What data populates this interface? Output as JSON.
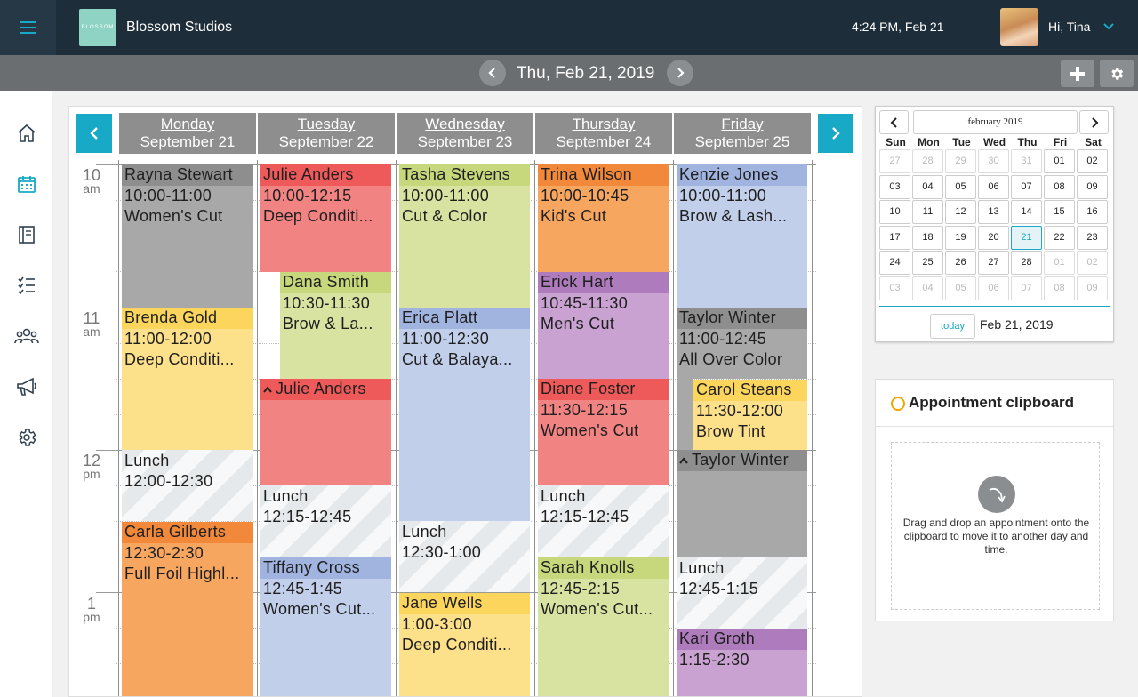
{
  "header": {
    "brand": "Blossom Studios",
    "logo_text": "BLOSSOM",
    "time": "4:24 PM, Feb 21",
    "greeting": "Hi, Tina"
  },
  "datebar": {
    "title": "Thu, Feb 21, 2019"
  },
  "sidebar": {
    "items": [
      "home-icon",
      "calendar-icon",
      "book-icon",
      "checklist-icon",
      "people-icon",
      "megaphone-icon",
      "gear-icon"
    ]
  },
  "calendar": {
    "days": [
      {
        "name": "Monday",
        "date": "September 21"
      },
      {
        "name": "Tuesday",
        "date": "September 22"
      },
      {
        "name": "Wednesday",
        "date": "September 23"
      },
      {
        "name": "Thursday",
        "date": "September 24"
      },
      {
        "name": "Friday",
        "date": "September 25"
      }
    ],
    "hours": [
      {
        "h": "10",
        "ap": "am"
      },
      {
        "h": "11",
        "ap": "am"
      },
      {
        "h": "12",
        "ap": "pm"
      },
      {
        "h": "1",
        "ap": "pm"
      }
    ],
    "appointments": {
      "mon": [
        {
          "name": "Rayna Stewart",
          "time": "10:00-11:00",
          "service": "Women's Cut"
        },
        {
          "name": "Brenda Gold",
          "time": "11:00-12:00",
          "service": "Deep Conditi..."
        },
        {
          "name": "Lunch",
          "time": "12:00-12:30"
        },
        {
          "name": "Carla Gilberts",
          "time": "12:30-2:30",
          "service": "Full Foil Highl..."
        }
      ],
      "tue": [
        {
          "name": "Julie Anders",
          "time": "10:00-12:15",
          "service": "Deep Conditi..."
        },
        {
          "name": "Dana Smith",
          "time": "10:30-11:30",
          "service": "Brow & La..."
        },
        {
          "name": "Julie Anders"
        },
        {
          "name": "Lunch",
          "time": "12:15-12:45"
        },
        {
          "name": "Tiffany Cross",
          "time": "12:45-1:45",
          "service": "Women's Cut..."
        }
      ],
      "wed": [
        {
          "name": "Tasha Stevens",
          "time": "10:00-11:00",
          "service": "Cut & Color"
        },
        {
          "name": "Erica Platt",
          "time": "11:00-12:30",
          "service": "Cut & Balaya..."
        },
        {
          "name": "Lunch",
          "time": "12:30-1:00"
        },
        {
          "name": "Jane Wells",
          "time": "1:00-3:00",
          "service": "Deep Conditi..."
        }
      ],
      "thu": [
        {
          "name": "Trina Wilson",
          "time": "10:00-10:45",
          "service": "Kid's Cut"
        },
        {
          "name": "Erick Hart",
          "time": "10:45-11:30",
          "service": "Men's Cut"
        },
        {
          "name": "Diane Foster",
          "time": "11:30-12:15",
          "service": "Women's Cut"
        },
        {
          "name": "Lunch",
          "time": "12:15-12:45"
        },
        {
          "name": "Sarah Knolls",
          "time": "12:45-2:15",
          "service": "Women's Cut..."
        }
      ],
      "fri": [
        {
          "name": "Kenzie Jones",
          "time": "10:00-11:00",
          "service": "Brow & Lash..."
        },
        {
          "name": "Taylor Winter",
          "time": "11:00-12:45",
          "service": "All Over Color"
        },
        {
          "name": "Carol Steans",
          "time": "11:30-12:00",
          "service": "Brow Tint"
        },
        {
          "name": "Taylor Winter"
        },
        {
          "name": "Lunch",
          "time": "12:45-1:15"
        },
        {
          "name": "Kari Groth",
          "time": "1:15-2:30"
        }
      ]
    }
  },
  "minical": {
    "month": "february 2019",
    "dow": [
      "Sun",
      "Mon",
      "Tue",
      "Wed",
      "Thu",
      "Fri",
      "Sat"
    ],
    "weeks": [
      [
        "27",
        "28",
        "29",
        "30",
        "31",
        "01",
        "02"
      ],
      [
        "03",
        "04",
        "05",
        "06",
        "07",
        "08",
        "09"
      ],
      [
        "10",
        "11",
        "12",
        "13",
        "14",
        "15",
        "16"
      ],
      [
        "17",
        "18",
        "19",
        "20",
        "21",
        "22",
        "23"
      ],
      [
        "24",
        "25",
        "26",
        "27",
        "28",
        "01",
        "02"
      ],
      [
        "03",
        "04",
        "05",
        "06",
        "07",
        "08",
        "09"
      ]
    ],
    "selected": "21",
    "today_label": "today",
    "current_date": "Feb 21, 2019"
  },
  "clipboard": {
    "title": "Appointment clipboard",
    "hint": "Drag and drop an appointment onto the clipboard to move it to another day and time."
  },
  "colors": {
    "accent": "#17a9c6",
    "gray": "#a8a8a8",
    "gray_dark": "#8e8e8e",
    "red": "#f28383",
    "red_dark": "#ee5959",
    "green": "#d9e3a1",
    "green_dark": "#c7d77b",
    "orange": "#f7a660",
    "orange_dark": "#f2883a",
    "purple": "#c9a2d2",
    "purple_dark": "#ae7cbd",
    "blue": "#c2cfea",
    "blue_dark": "#a1b4df",
    "yellow": "#fde08a",
    "yellow_dark": "#fcd55d"
  }
}
